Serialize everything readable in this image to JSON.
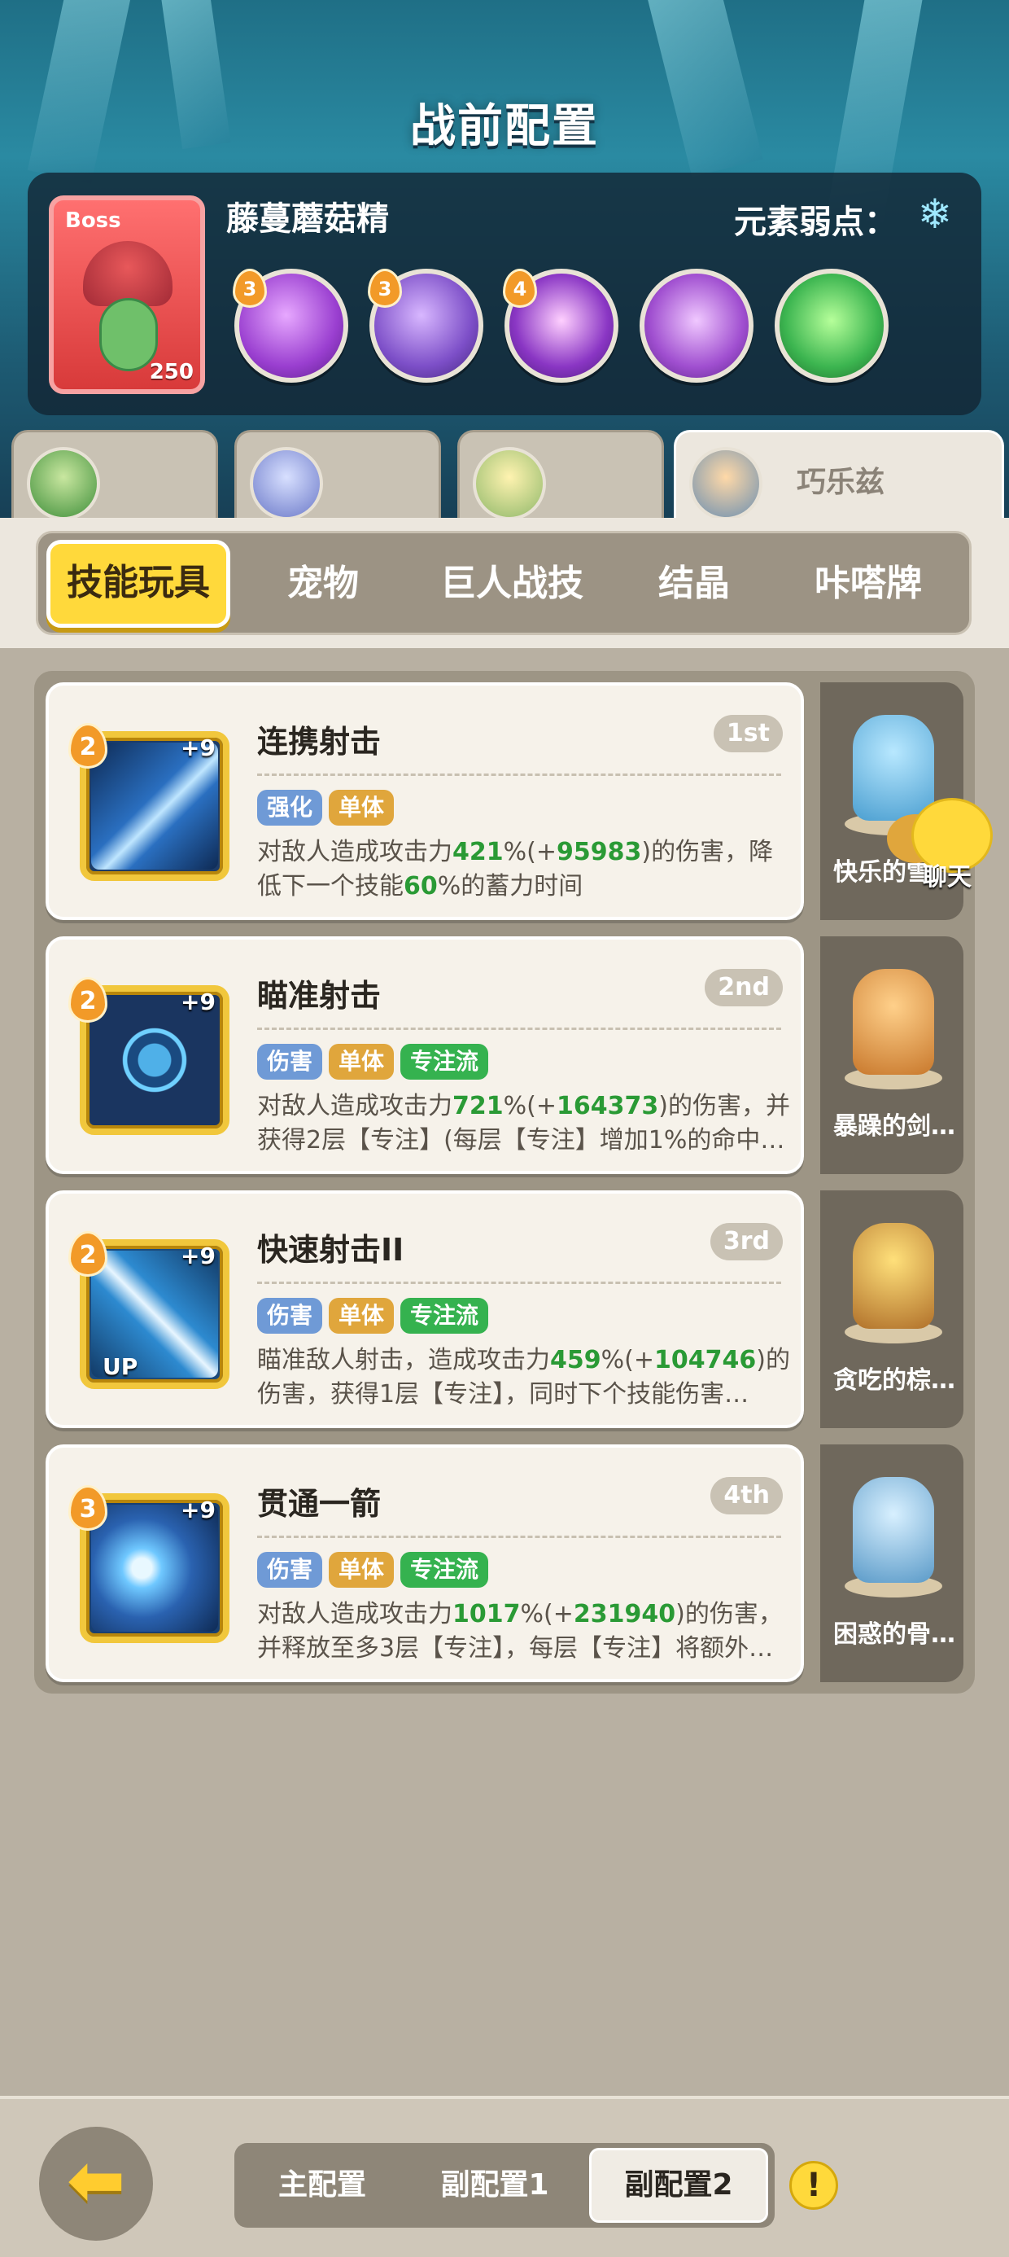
{
  "header": {
    "title": "战前配置"
  },
  "boss": {
    "tag": "Boss",
    "level": "250",
    "name": "藤蔓蘑菇精",
    "weakness_label": "元素弱点：",
    "weakness_icon": "snowflake-icon",
    "skills": [
      {
        "level": "3",
        "color": "#9a3fd0"
      },
      {
        "level": "3",
        "color": "#7d4fc8"
      },
      {
        "level": "4",
        "color": "#8a36c4"
      },
      {
        "level": "",
        "color": "#a04fd0"
      },
      {
        "level": "",
        "color": "#3cb550"
      }
    ]
  },
  "characters": [
    {
      "name": ""
    },
    {
      "name": ""
    },
    {
      "name": ""
    },
    {
      "name": "巧乐兹",
      "active": true
    }
  ],
  "tabs": {
    "items": [
      "技能玩具",
      "宠物",
      "巨人战技",
      "结晶",
      "咔嗒牌"
    ],
    "active_index": 0
  },
  "skills": [
    {
      "name": "连携射击",
      "rank": "1st",
      "level": "2",
      "plus": "+9",
      "upgraded": false,
      "tags": [
        {
          "text": "强化",
          "kind": "blue"
        },
        {
          "text": "单体",
          "kind": "gold"
        }
      ],
      "desc_parts": [
        {
          "t": "对敌人造成攻击力"
        },
        {
          "t": "421",
          "hl": true
        },
        {
          "t": "%(+"
        },
        {
          "t": "95983",
          "hl": true
        },
        {
          "t": ")的伤害，降低下一个技能"
        },
        {
          "t": "60",
          "hl": true
        },
        {
          "t": "%的蓄力时间"
        }
      ],
      "icon_color": "#2a6fc0",
      "pet": {
        "name": "快乐的雪",
        "color": "#6ec6e8"
      }
    },
    {
      "name": "瞄准射击",
      "rank": "2nd",
      "level": "2",
      "plus": "+9",
      "upgraded": false,
      "tags": [
        {
          "text": "伤害",
          "kind": "blue"
        },
        {
          "text": "单体",
          "kind": "gold"
        },
        {
          "text": "专注流",
          "kind": "green"
        }
      ],
      "desc_parts": [
        {
          "t": "对敌人造成攻击力"
        },
        {
          "t": "721",
          "hl": true
        },
        {
          "t": "%(+"
        },
        {
          "t": "164373",
          "hl": true
        },
        {
          "t": ")的伤害，并获得2层【专注】(每层【专注】增加1%的命中…"
        }
      ],
      "icon_color": "#2a5a9a",
      "pet": {
        "name": "暴躁的剑…",
        "color": "#e8a348"
      }
    },
    {
      "name": "快速射击II",
      "rank": "3rd",
      "level": "2",
      "plus": "+9",
      "upgraded": true,
      "tags": [
        {
          "text": "伤害",
          "kind": "blue"
        },
        {
          "text": "单体",
          "kind": "gold"
        },
        {
          "text": "专注流",
          "kind": "green"
        }
      ],
      "desc_parts": [
        {
          "t": "瞄准敌人射击，造成攻击力"
        },
        {
          "t": "459",
          "hl": true
        },
        {
          "t": "%(+"
        },
        {
          "t": "104746",
          "hl": true
        },
        {
          "t": ")的伤害，获得1层【专注】，同时下个技能伤害…"
        }
      ],
      "icon_color": "#2d8ad0",
      "up_label": "UP",
      "pet": {
        "name": "贪吃的棕…",
        "color": "#c98a3c"
      }
    },
    {
      "name": "贯通一箭",
      "rank": "4th",
      "level": "3",
      "plus": "+9",
      "upgraded": false,
      "tags": [
        {
          "text": "伤害",
          "kind": "blue"
        },
        {
          "text": "单体",
          "kind": "gold"
        },
        {
          "text": "专注流",
          "kind": "green"
        }
      ],
      "desc_parts": [
        {
          "t": "对敌人造成攻击力"
        },
        {
          "t": "1017",
          "hl": true
        },
        {
          "t": "%(+"
        },
        {
          "t": "231940",
          "hl": true
        },
        {
          "t": ")的伤害，并释放至多3层【专注】，每层【专注】将额外…"
        }
      ],
      "icon_color": "#3a7fd8",
      "pet": {
        "name": "困惑的骨…",
        "color": "#6fb0d8"
      }
    }
  ],
  "chat": {
    "label": "聊天"
  },
  "bottom": {
    "back_icon": "back-arrow-icon",
    "configs": [
      "主配置",
      "副配置1",
      "副配置2"
    ],
    "active_config": 2,
    "warn_symbol": "!"
  }
}
